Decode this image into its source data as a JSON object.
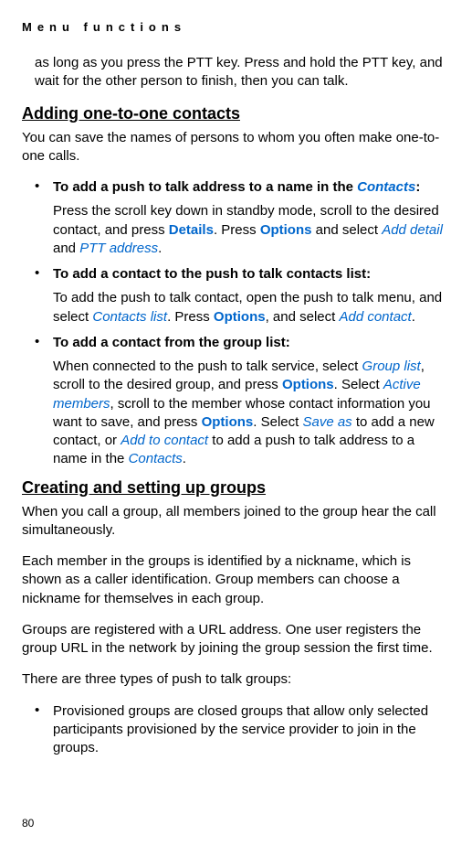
{
  "header": "Menu functions",
  "intro_paragraph_pre": "as long as you press the PTT key. Press and hold the PTT key, and wait for the other person to finish, then you can talk.",
  "section1": {
    "heading": "Adding one-to-one contacts",
    "intro": "You can save the names of persons to whom you often make one-to-one calls.",
    "bullets": [
      {
        "head_pre": "To add a push to talk address to a name in the ",
        "head_link": "Contacts",
        "head_post": ":",
        "body_parts": [
          {
            "t": "Press the scroll key down in standby mode, scroll to the desired contact, and press "
          },
          {
            "t": "Details",
            "cls": "bold-blue"
          },
          {
            "t": ". Press "
          },
          {
            "t": "Options",
            "cls": "bold-blue"
          },
          {
            "t": " and select "
          },
          {
            "t": "Add detail",
            "cls": "link"
          },
          {
            "t": " and "
          },
          {
            "t": "PTT address",
            "cls": "link"
          },
          {
            "t": "."
          }
        ]
      },
      {
        "head_pre": "To add a contact to the push to talk contacts list:",
        "body_parts": [
          {
            "t": "To add the push to talk contact, open the push to talk menu, and select "
          },
          {
            "t": "Contacts list",
            "cls": "link"
          },
          {
            "t": ". Press "
          },
          {
            "t": "Options",
            "cls": "bold-blue"
          },
          {
            "t": ", and select "
          },
          {
            "t": "Add contact",
            "cls": "link"
          },
          {
            "t": "."
          }
        ]
      },
      {
        "head_pre": "To add a contact from the group list:",
        "body_parts": [
          {
            "t": "When connected to the push to talk service, select "
          },
          {
            "t": "Group list",
            "cls": "link"
          },
          {
            "t": ", scroll to the desired group, and press "
          },
          {
            "t": "Options",
            "cls": "bold-blue"
          },
          {
            "t": ". Select "
          },
          {
            "t": "Active members",
            "cls": "link"
          },
          {
            "t": ", scroll to the member whose contact information you want to save, and press "
          },
          {
            "t": "Options",
            "cls": "bold-blue"
          },
          {
            "t": ". Select "
          },
          {
            "t": "Save as",
            "cls": "link"
          },
          {
            "t": " to add a new contact, or "
          },
          {
            "t": "Add to contact",
            "cls": "link"
          },
          {
            "t": " to add a push to talk address to a name in the "
          },
          {
            "t": "Contacts",
            "cls": "link"
          },
          {
            "t": "."
          }
        ]
      }
    ]
  },
  "section2": {
    "heading": "Creating and setting up groups",
    "paragraphs": [
      "When you call a group, all members joined to the group hear the call simultaneously.",
      "Each member in the groups is identified by a nickname, which is shown as a caller identification. Group members can choose a nickname for themselves in each group.",
      "Groups are registered with a URL address. One user registers the group URL in the network by joining the group session the first time.",
      "There are three types of push to talk groups:"
    ],
    "bullets": [
      {
        "text": "Provisioned groups are closed groups that allow only selected participants provisioned by the service provider to join in the groups."
      }
    ]
  },
  "page_number": "80"
}
